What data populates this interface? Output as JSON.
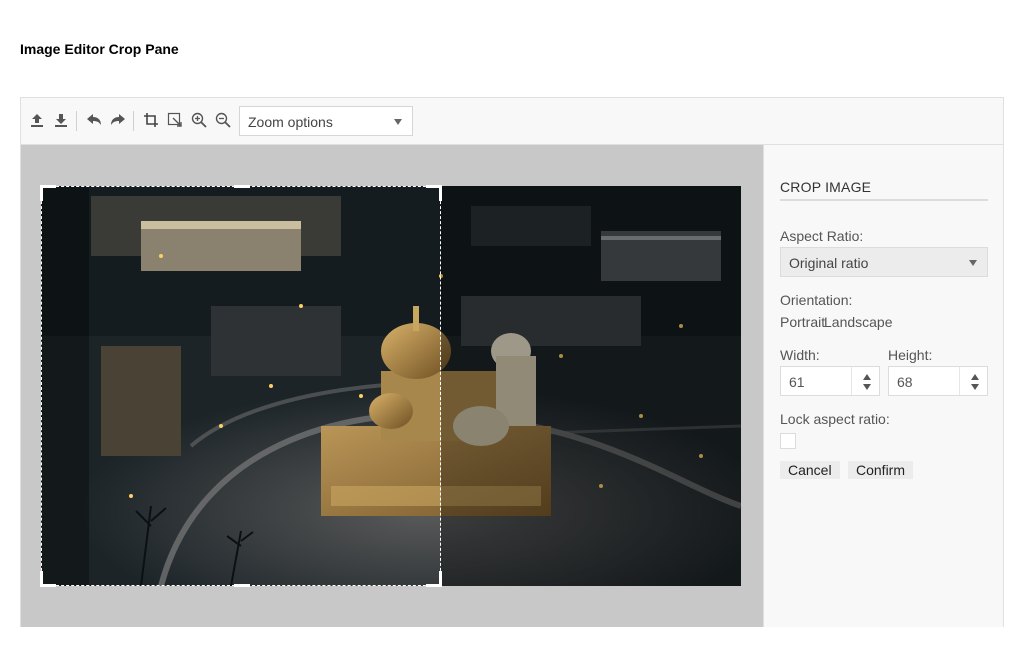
{
  "page": {
    "title": "Image Editor Crop Pane"
  },
  "toolbar": {
    "tools": [
      {
        "name": "open-icon"
      },
      {
        "name": "download-icon"
      },
      {
        "name": "undo-icon"
      },
      {
        "name": "redo-icon"
      },
      {
        "name": "crop-icon"
      },
      {
        "name": "transform-icon"
      },
      {
        "name": "zoom-in-icon"
      },
      {
        "name": "zoom-out-icon"
      }
    ],
    "zoom_placeholder": "Zoom options"
  },
  "crop_panel": {
    "title": "CROP IMAGE",
    "aspect_label": "Aspect Ratio:",
    "aspect_value": "Original ratio",
    "orientation_label": "Orientation:",
    "portrait": "Portrait",
    "landscape": "Landscape",
    "width_label": "Width:",
    "width_value": "61",
    "height_label": "Height:",
    "height_value": "68",
    "lock_label": "Lock aspect ratio:",
    "lock_checked": false,
    "cancel": "Cancel",
    "confirm": "Confirm"
  },
  "colors": {
    "canvas_bg": "#c8c8c8",
    "panel_bg": "#f8f8f8",
    "crop_outline": "#ffffff"
  }
}
